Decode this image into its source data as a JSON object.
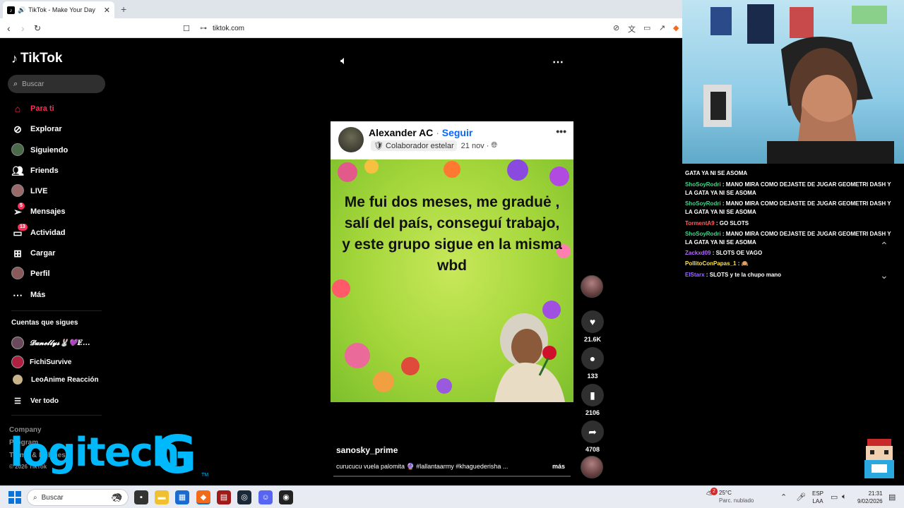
{
  "browser": {
    "tab_title": "TikTok - Make Your Day",
    "tab_close": "✕",
    "new_tab": "+",
    "url": "tiktok.com"
  },
  "tiktok": {
    "logo": "TikTok",
    "search_placeholder": "Buscar",
    "nav": [
      {
        "label": "Para ti",
        "icon": "home-icon"
      },
      {
        "label": "Explorar",
        "icon": "compass-icon"
      },
      {
        "label": "Siguiendo",
        "icon": "avatar"
      },
      {
        "label": "Friends",
        "icon": "friends-icon"
      },
      {
        "label": "LIVE",
        "icon": "avatar"
      },
      {
        "label": "Mensajes",
        "icon": "send-icon",
        "badge": "5"
      },
      {
        "label": "Actividad",
        "icon": "inbox-icon",
        "badge": "13"
      },
      {
        "label": "Cargar",
        "icon": "upload-icon"
      },
      {
        "label": "Perfil",
        "icon": "avatar"
      },
      {
        "label": "Más",
        "icon": "more-icon"
      }
    ],
    "following_title": "Cuentas que sigues",
    "following": [
      {
        "name": "𝓓𝓪𝓷𝓮𝓵𝓵𝔂𝓼🐰💜Ɇ..."
      },
      {
        "name": "FichiSurvive"
      },
      {
        "name": "LeoAnime Reacción"
      }
    ],
    "see_all": "Ver todo",
    "footer": [
      "Company",
      "Program",
      "Terms & Policies",
      "© 2026 TikTok"
    ],
    "watermark": "logitech",
    "watermark_g": "G",
    "watermark_tm": "TM"
  },
  "post": {
    "name": "Alexander AC",
    "separator": "·",
    "follow": "Seguir",
    "badge": "Colaborador estelar",
    "date": "21 nov ·",
    "text": "Me fui dos meses, me graduė , salí del país, conseguí trabajo, y este grupo sigue en la misma wbd"
  },
  "video": {
    "author": "sanosky_prime",
    "caption": "curucucu vuela palomita 🔮 #lallantaarmy #khaguederisha ...",
    "more": "más",
    "progress": 0.0,
    "likes": "21.6K",
    "comments": "133",
    "saves": "2106",
    "shares": "4708"
  },
  "chat": [
    {
      "user": "",
      "user_color": "#ffffff",
      "text": "GATA YA NI SE ASOMA"
    },
    {
      "user": "ShoSoyRodri",
      "user_color": "#3dd68c",
      "text": "MANO MIRA COMO DEJASTE DE JUGAR GEOMETRI DASH Y LA GATA YA NI SE ASOMA"
    },
    {
      "user": "ShoSoyRodri",
      "user_color": "#3dd68c",
      "text": "MANO MIRA COMO DEJASTE DE JUGAR GEOMETRI DASH Y LA GATA YA NI SE ASOMA"
    },
    {
      "user": "TormentA9",
      "user_color": "#ff5f5f",
      "text": "GO SLOTS"
    },
    {
      "user": "ShoSoyRodri",
      "user_color": "#3dd68c",
      "text": "MANO MIRA COMO DEJASTE DE JUGAR GEOMETRI DASH Y LA GATA YA NI SE ASOMA"
    },
    {
      "user": "Zackxd09",
      "user_color": "#b36bff",
      "text": "SLOTS OE VAGO"
    },
    {
      "user": "PollitoConPapas_1",
      "user_color": "#ffe14d",
      "text": "🙉"
    },
    {
      "user": "ElStarx",
      "user_color": "#9b6bff",
      "text": "SLOTS y te la chupo mano"
    }
  ],
  "taskbar": {
    "search": "Buscar",
    "weather_badge": "2",
    "temp": "25°C",
    "weather": "Parc. nublado",
    "lang1": "ESP",
    "lang2": "LAA",
    "time": "21:31",
    "date": "9/02/2026"
  },
  "colors": {
    "accent": "#fe2c55",
    "fb_blue": "#0866ff",
    "logitech": "#00b8fc"
  }
}
